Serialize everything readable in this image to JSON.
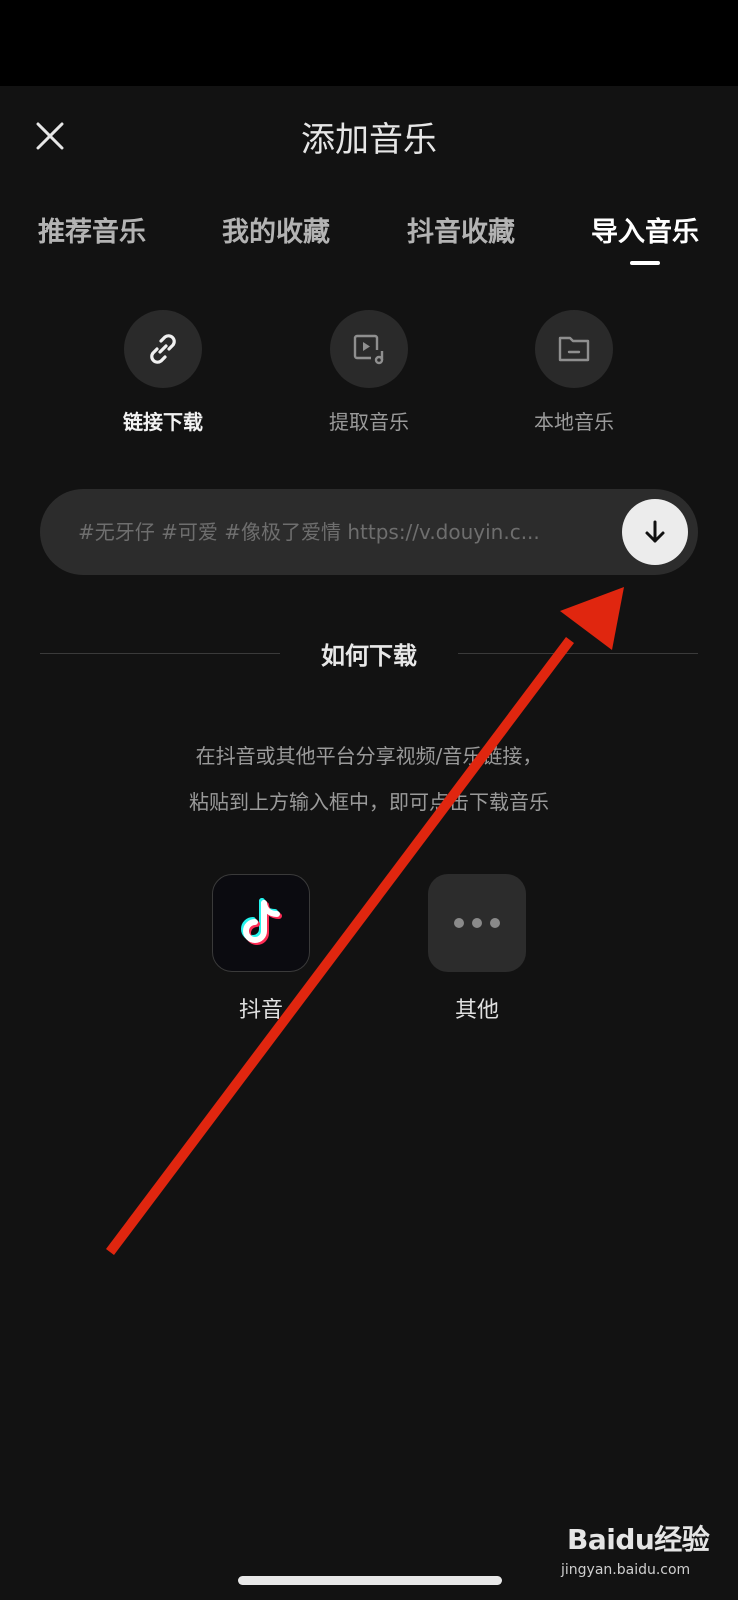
{
  "header": {
    "title": "添加音乐",
    "close_icon": "close-icon"
  },
  "tabs": [
    {
      "label": "推荐音乐",
      "active": false
    },
    {
      "label": "我的收藏",
      "active": false
    },
    {
      "label": "抖音收藏",
      "active": false
    },
    {
      "label": "导入音乐",
      "active": true
    }
  ],
  "sources": [
    {
      "label": "链接下载",
      "icon": "link-icon",
      "active": true
    },
    {
      "label": "提取音乐",
      "icon": "video-music-icon",
      "active": false
    },
    {
      "label": "本地音乐",
      "icon": "folder-icon",
      "active": false
    }
  ],
  "url_input": {
    "placeholder": "#无牙仔 #可爱 #像极了爱情 https://v.douyin.c...",
    "value": "",
    "button_icon": "download-arrow-icon"
  },
  "howto": {
    "title": "如何下载",
    "line1": "在抖音或其他平台分享视频/音乐链接，",
    "line2": "粘贴到上方输入框中，即可点击下载音乐"
  },
  "apps": [
    {
      "label": "抖音",
      "icon": "tiktok-icon"
    },
    {
      "label": "其他",
      "icon": "more-dots-icon"
    }
  ],
  "watermark": {
    "brand": "Baidu经验",
    "url": "jingyan.baidu.com"
  },
  "colors": {
    "background": "#121212",
    "surface": "#2c2c2c",
    "annotation_arrow": "#e0260f"
  }
}
